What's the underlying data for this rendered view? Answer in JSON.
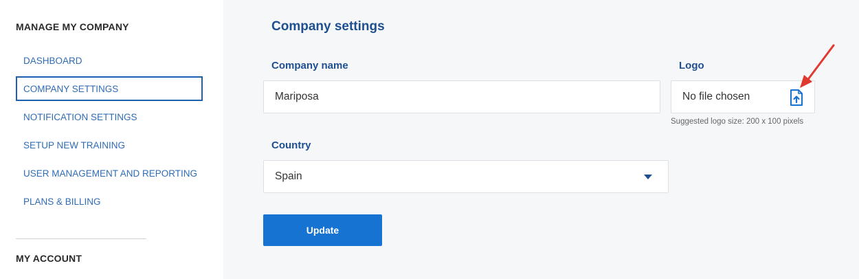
{
  "sidebar": {
    "heading_manage": "MANAGE MY COMPANY",
    "items": [
      {
        "label": "DASHBOARD"
      },
      {
        "label": "COMPANY SETTINGS"
      },
      {
        "label": "NOTIFICATION SETTINGS"
      },
      {
        "label": "SETUP NEW TRAINING"
      },
      {
        "label": "USER MANAGEMENT AND REPORTING"
      },
      {
        "label": "PLANS & BILLING"
      }
    ],
    "active_item": "COMPANY SETTINGS",
    "heading_account": "MY ACCOUNT"
  },
  "main": {
    "title": "Company settings",
    "company_name": {
      "label": "Company name",
      "value": "Mariposa"
    },
    "logo": {
      "label": "Logo",
      "file_text": "No file chosen",
      "hint": "Suggested logo size: 200 x 100 pixels",
      "icon": "file-upload-icon"
    },
    "country": {
      "label": "Country",
      "selected": "Spain",
      "icon": "caret-down-icon"
    },
    "update_label": "Update"
  },
  "annotation": {
    "icon": "red-arrow-icon",
    "color": "#e03a2f"
  },
  "colors": {
    "accent": "#1773d2",
    "heading": "#1d4f91",
    "link": "#2f6cb5"
  }
}
